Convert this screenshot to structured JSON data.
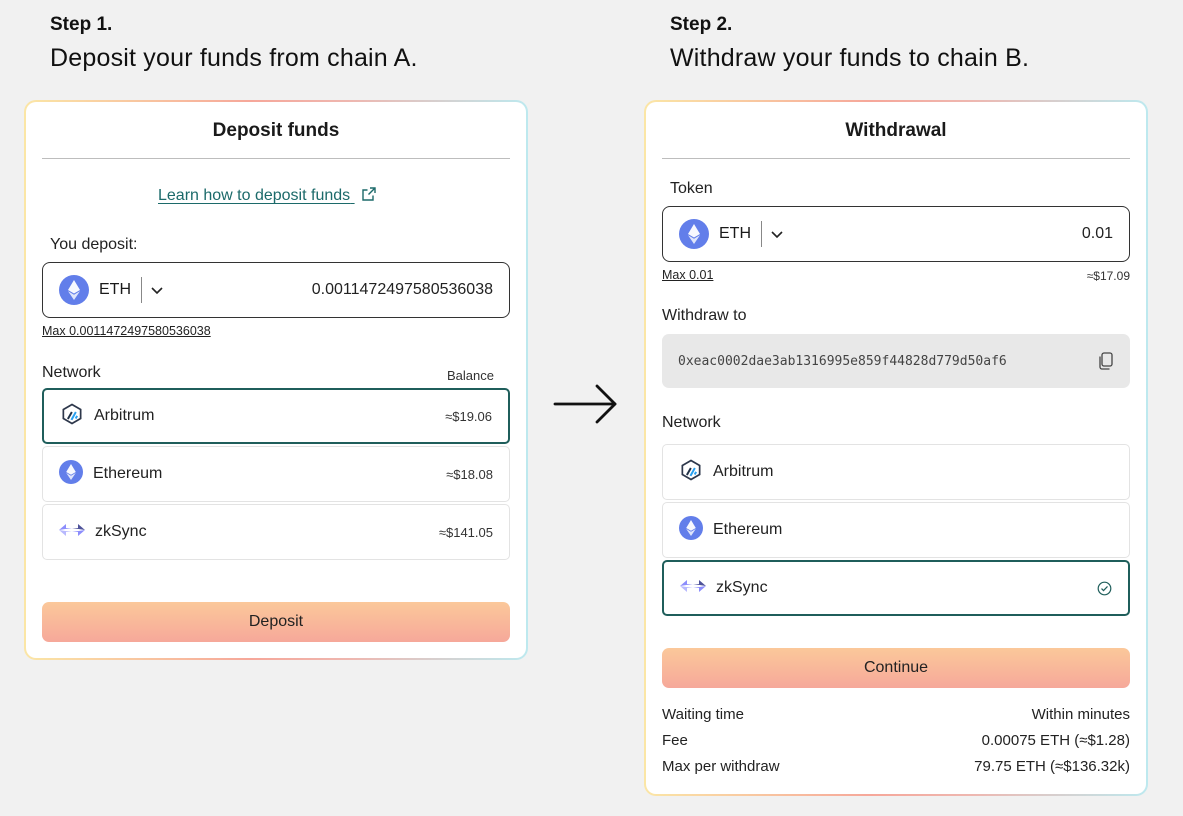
{
  "step1": {
    "num": "Step 1.",
    "desc": "Deposit your funds from chain A."
  },
  "step2": {
    "num": "Step 2.",
    "desc": "Withdraw your funds to chain B."
  },
  "deposit": {
    "title": "Deposit funds",
    "learn_link": "Learn how to deposit funds",
    "you_deposit_label": "You deposit:",
    "token": "ETH",
    "amount": "0.0011472497580536038",
    "max": "Max 0.0011472497580536038",
    "network_label": "Network",
    "balance_label": "Balance",
    "networks": [
      {
        "name": "Arbitrum",
        "balance": "≈$19.06"
      },
      {
        "name": "Ethereum",
        "balance": "≈$18.08"
      },
      {
        "name": "zkSync",
        "balance": "≈$141.05"
      }
    ],
    "button": "Deposit"
  },
  "withdraw": {
    "title": "Withdrawal",
    "token_label": "Token",
    "token": "ETH",
    "amount": "0.01",
    "max": "Max 0.01",
    "usd": "≈$17.09",
    "withdraw_to_label": "Withdraw to",
    "address": "0xeac0002dae3ab1316995e859f44828d779d50af6",
    "network_label": "Network",
    "networks": [
      {
        "name": "Arbitrum"
      },
      {
        "name": "Ethereum"
      },
      {
        "name": "zkSync"
      }
    ],
    "button": "Continue",
    "info": [
      {
        "label": "Waiting time",
        "value": "Within minutes"
      },
      {
        "label": "Fee",
        "value": "0.00075 ETH (≈$1.28)"
      },
      {
        "label": "Max per withdraw",
        "value": "79.75 ETH (≈$136.32k)"
      }
    ]
  },
  "colors": {
    "accent": "#1f5e5b",
    "link": "#1c6a6a",
    "button": "#f6a89a"
  },
  "icons": [
    "ethereum-icon",
    "arbitrum-icon",
    "zksync-icon",
    "chevron-down-icon",
    "external-link-icon",
    "copy-icon",
    "check-circle-icon",
    "arrow-right-icon"
  ]
}
